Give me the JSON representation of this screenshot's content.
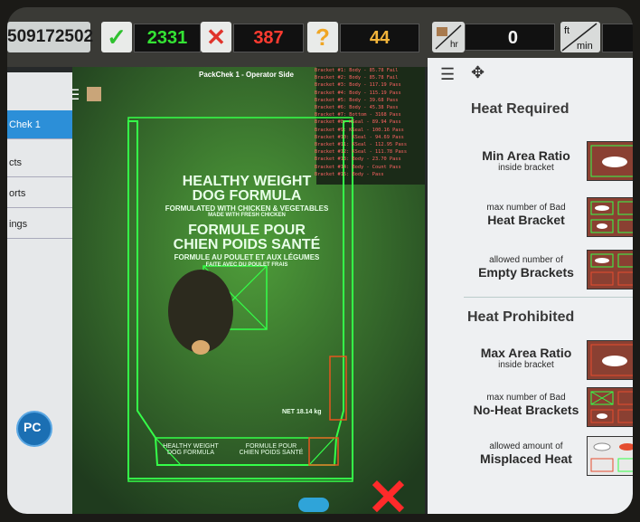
{
  "header": {
    "serial": "509172502",
    "good_count": "2331",
    "bad_count": "387",
    "unknown_count": "44",
    "rate_unit": "hr",
    "rate_value": "0",
    "speed_unit_top": "ft",
    "speed_unit_bottom": "min"
  },
  "sidebar": {
    "items": [
      {
        "label": "Chek 1"
      },
      {
        "label": "cts"
      },
      {
        "label": "orts"
      },
      {
        "label": "ings"
      }
    ],
    "logo_text": "PC"
  },
  "viewer": {
    "title": "PackChek 1 - Operator Side",
    "bag_lines": [
      "HEALTHY WEIGHT",
      "DOG FORMULA",
      "FORMULATED WITH CHICKEN & VEGETABLES",
      "MADE WITH FRESH CHICKEN",
      "FORMULE POUR",
      "CHIEN POIDS SANTÉ",
      "FORMULE AU POULET ET AUX LÉGUMES",
      "FAITE AVEC DU POULET FRAIS"
    ],
    "net_weight": "NET 18.14 kg",
    "bottom_text_left": "HEALTHY WEIGHT DOG FORMULA",
    "bottom_text_right": "FORMULE POUR CHIEN POIDS SANTÉ",
    "log_lines": [
      "Bracket #1: Body - 85.78 Fail",
      "Bracket #2: Body - 85.78 Fail",
      "Bracket #3: Body - 117.19 Pass",
      "Bracket #4: Body - 115.19 Pass",
      "Bracket #5: Body - 39.68 Pass",
      "Bracket #6: Body - 45.38 Pass",
      "Bracket #7: Bottom - 3168 Pass",
      "Bracket #8: KSeal - 89.94 Pass",
      "Bracket #9: KSeal - 100.16 Pass",
      "Bracket #10: KSeal - 94.69 Pass",
      "Bracket #11: KSeal - 112.95 Pass",
      "Bracket #12: KSeal - 111.78 Pass",
      "Bracket #13: Body - 23.70 Pass",
      "Bracket #14: Body - Count Pass",
      "Bracket #15: Body - Pass"
    ]
  },
  "right_panel": {
    "heat_required": "Heat Required",
    "min_area_ratio_big": "Min Area Ratio",
    "min_area_ratio_small": "inside bracket",
    "bad_heat_small": "max number of Bad",
    "bad_heat_big": "Heat Bracket",
    "empty_small": "allowed number of",
    "empty_big": "Empty Brackets",
    "heat_prohibited": "Heat Prohibited",
    "max_area_ratio_big": "Max Area Ratio",
    "max_area_ratio_small": "inside bracket",
    "no_heat_small": "max number of Bad",
    "no_heat_big": "No-Heat Brackets",
    "misplaced_small": "allowed amount of",
    "misplaced_big": "Misplaced Heat"
  },
  "colors": {
    "good": "#2fd12f",
    "bad": "#e53a2f",
    "unknown": "#f0a623",
    "overlay": "#35ff49"
  }
}
